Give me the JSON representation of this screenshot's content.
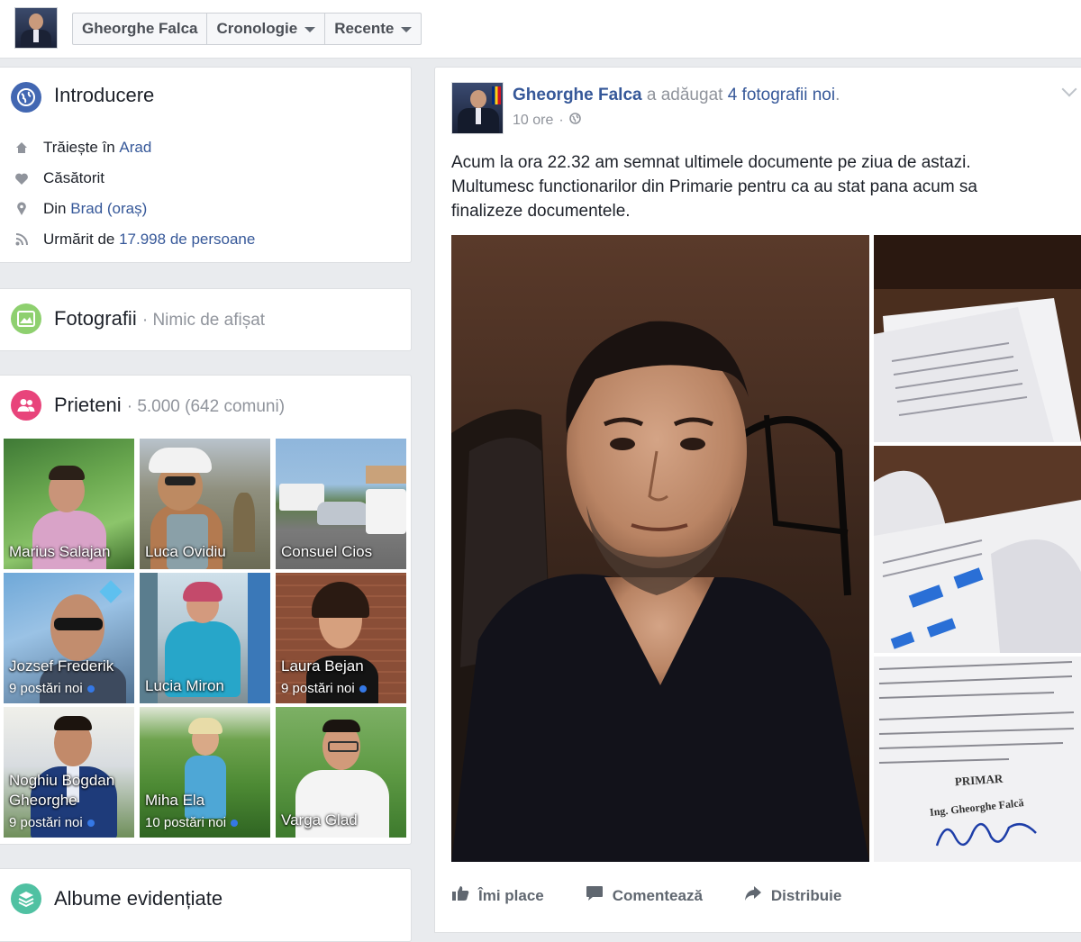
{
  "topbar": {
    "tabs": [
      {
        "label": "Gheorghe Falca",
        "has_caret": false
      },
      {
        "label": "Cronologie",
        "has_caret": true
      },
      {
        "label": "Recente",
        "has_caret": true
      }
    ]
  },
  "intro": {
    "title": "Introducere",
    "icon": "globe-icon",
    "rows": [
      {
        "icon": "home-icon",
        "prefix": "Trăiește în ",
        "link": "Arad",
        "suffix": ""
      },
      {
        "icon": "heart-icon",
        "prefix": "Căsătorit",
        "link": "",
        "suffix": ""
      },
      {
        "icon": "location-pin-icon",
        "prefix": "Din ",
        "link": "Brad (oraș)",
        "suffix": ""
      },
      {
        "icon": "rss-icon",
        "prefix": "Urmărit de ",
        "link": "17.998 de persoane",
        "suffix": ""
      }
    ]
  },
  "photos": {
    "title": "Fotografii",
    "subtitle": "· Nimic de afișat",
    "icon": "photo-icon"
  },
  "friends": {
    "title": "Prieteni",
    "subtitle": "· 5.000 (642 comuni)",
    "icon": "friends-icon",
    "items": [
      {
        "name": "Marius Salajan",
        "posts": ""
      },
      {
        "name": "Luca Ovidiu",
        "posts": ""
      },
      {
        "name": "Consuel Cios",
        "posts": ""
      },
      {
        "name": "Jozsef Frederik",
        "posts": "9 postări noi"
      },
      {
        "name": "Lucia Miron",
        "posts": ""
      },
      {
        "name": "Laura Bejan",
        "posts": "9 postări noi"
      },
      {
        "name": "Noghiu Bogdan Gheorghe",
        "posts": "9 postări noi"
      },
      {
        "name": "Miha Ela",
        "posts": "10 postări noi"
      },
      {
        "name": "Varga Glad",
        "posts": ""
      }
    ]
  },
  "albums": {
    "title": "Albume evidențiate",
    "icon": "albums-icon"
  },
  "post": {
    "author": "Gheorghe Falca",
    "action_text": " a adăugat ",
    "action_link": "4 fotografii noi",
    "action_end": ".",
    "time": "10 ore",
    "privacy_icon": "globe-icon",
    "text": "Acum la ora 22.32 am semnat ultimele documente pe ziua de astazi. Multumesc functionarilor din Primarie pentru ca au stat pana acum sa finalizeze documentele.",
    "actions": [
      {
        "label": "Îmi place",
        "icon": "thumbs-up-icon"
      },
      {
        "label": "Comentează",
        "icon": "comment-icon"
      },
      {
        "label": "Distribuie",
        "icon": "share-icon"
      }
    ],
    "document_signature": {
      "title": "PRIMAR",
      "name": "Ing. Gheorghe Falcă"
    }
  }
}
